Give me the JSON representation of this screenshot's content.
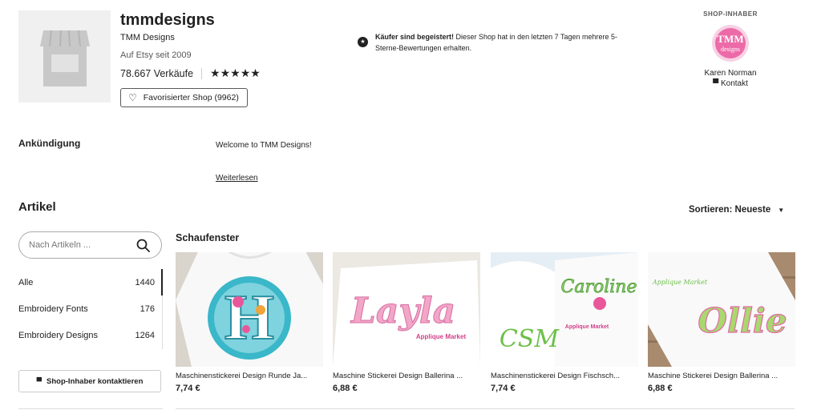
{
  "shop": {
    "name": "tmmdesigns",
    "subtitle": "TMM Designs",
    "since": "Auf Etsy seit 2009",
    "sales": "78.667 Verkäufe",
    "stars": "★★★★★",
    "favorite_label": "Favorisierter Shop (9962)"
  },
  "buyers_note": {
    "bold": "Käufer sind begeistert!",
    "text": " Dieser Shop hat in den letzten 7 Tagen mehrere 5-Sterne-Bewertungen erhalten."
  },
  "owner": {
    "heading": "SHOP-INHABER",
    "name": "Karen Norman",
    "contact": "Kontakt",
    "avatar_text": "TMM designs"
  },
  "announcement": {
    "heading": "Ankündigung",
    "text": "Welcome to TMM Designs!",
    "more": "Weiterlesen"
  },
  "items": {
    "heading": "Artikel",
    "sort_label": "Sortieren: Neueste",
    "search_placeholder": "Nach Artikeln ...",
    "categories": [
      {
        "label": "Alle",
        "count": "1440"
      },
      {
        "label": "Embroidery Fonts",
        "count": "176"
      },
      {
        "label": "Embroidery Designs",
        "count": "1264"
      }
    ],
    "contact_button": "Shop-Inhaber kontaktieren"
  },
  "showcase": {
    "heading": "Schaufenster",
    "listings": [
      {
        "title": "Maschinenstickerei Design Runde Ja...",
        "price": "7,74 €",
        "image_text": "H"
      },
      {
        "title": "Maschine Stickerei Design Ballerina ...",
        "price": "6,88 €",
        "image_text": "Layla",
        "brand_text": "Applique Market"
      },
      {
        "title": "Maschinenstickerei Design Fischsch...",
        "price": "7,74 €",
        "image_text": "Caroline",
        "mono_text": "CSM",
        "brand_text": "Applique Market"
      },
      {
        "title": "Maschine Stickerei Design Ballerina ...",
        "price": "6,88 €",
        "image_text": "Ollie",
        "brand_text": "Applique Market"
      }
    ]
  },
  "colors": {
    "text": "#222222",
    "muted": "#595959",
    "border": "#aaaaaa",
    "teal": "#3ab7c9",
    "pink": "#e986b8",
    "green": "#6cc04a"
  }
}
